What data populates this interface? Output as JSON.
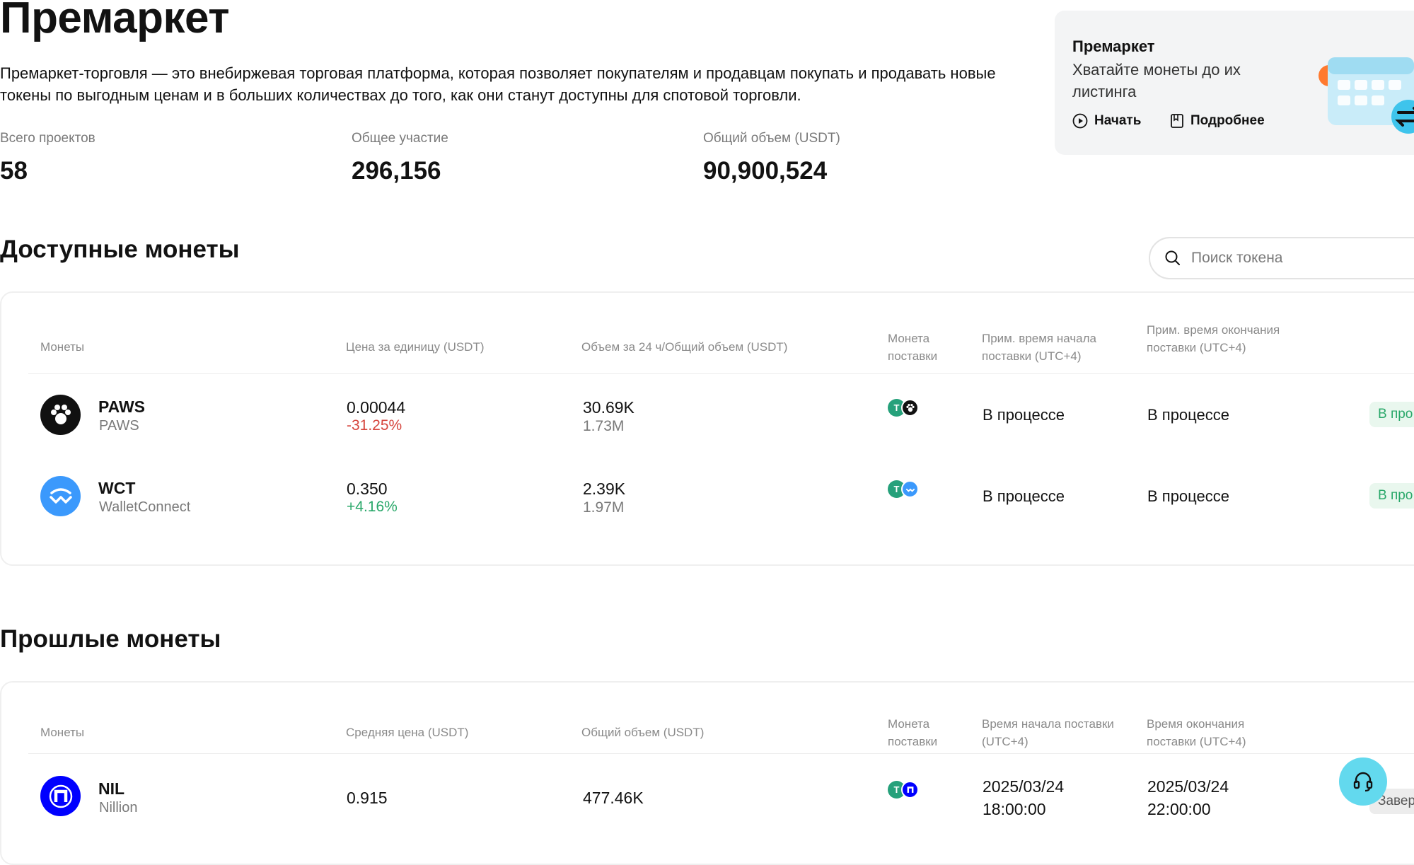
{
  "page": {
    "title": "Премаркет",
    "description": "Премаркет-торговля — это внебиржевая торговая платформа, которая позволяет покупателям и продавцам покупать и продавать новые токены по выгодным ценам и в больших количествах до того, как они станут доступны для спотовой торговли."
  },
  "stats": [
    {
      "label": "Всего проектов",
      "value": "58"
    },
    {
      "label": "Общее участие",
      "value": "296,156"
    },
    {
      "label": "Общий объем (USDT)",
      "value": "90,900,524"
    }
  ],
  "promo": {
    "title": "Премаркет",
    "subtitle": "Хватайте монеты до их листинга",
    "start_label": "Начать",
    "more_label": "Подробнее"
  },
  "available": {
    "title": "Доступные монеты",
    "search_placeholder": "Поиск токена",
    "headers": {
      "coins": "Монеты",
      "price": "Цена за единицу (USDT)",
      "volume": "Объем за 24 ч/Общий объем (USDT)",
      "delivery_coin": "Монета поставки",
      "start": "Прим. время начала поставки (UTC+4)",
      "end": "Прим. время окончания поставки (UTC+4)"
    },
    "rows": [
      {
        "symbol": "PAWS",
        "name": "PAWS",
        "price": "0.00044",
        "change": "-31.25%",
        "vol24": "30.69K",
        "vol_total": "1.73M",
        "start": "В процессе",
        "end": "В процессе",
        "status": "В про"
      },
      {
        "symbol": "WCT",
        "name": "WalletConnect",
        "price": "0.350",
        "change": "+4.16%",
        "vol24": "2.39K",
        "vol_total": "1.97M",
        "start": "В процессе",
        "end": "В процессе",
        "status": "В про"
      }
    ]
  },
  "past": {
    "title": "Прошлые монеты",
    "headers": {
      "coins": "Монеты",
      "avg_price": "Средняя цена (USDT)",
      "total_volume": "Общий объем (USDT)",
      "delivery_coin": "Монета поставки",
      "start": "Время начала поставки (UTC+4)",
      "end": "Время окончания поставки (UTC+4)"
    },
    "rows": [
      {
        "symbol": "NIL",
        "name": "Nillion",
        "avg_price": "0.915",
        "total_volume": "477.46K",
        "start_date": "2025/03/24",
        "start_time": "18:00:00",
        "end_date": "2025/03/24",
        "end_time": "22:00:00",
        "status": "Завер"
      }
    ]
  },
  "colors": {
    "positive": "#2aa86a",
    "negative": "#d6453d",
    "tether": "#26a17b",
    "wct": "#3b99fc",
    "nil": "#0000ff",
    "support": "#63d9ee"
  },
  "icons": [
    "paws-icon",
    "walletconnect-icon",
    "nillion-icon",
    "tether-icon",
    "search-icon",
    "play-icon",
    "book-icon",
    "calendar-icon",
    "swap-icon",
    "headset-icon"
  ]
}
